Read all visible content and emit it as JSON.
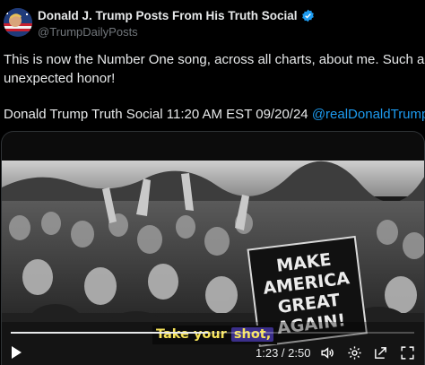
{
  "post": {
    "author_name": "Donald J. Trump Posts From His Truth Social",
    "author_handle": "@TrumpDailyPosts",
    "verified": true,
    "text_line1": "This is now the Number One song, across all charts, about me. Such an",
    "text_line2": "unexpected honor!",
    "text_line3": "Donald Trump Truth Social 11:20 AM EST 09/20/24",
    "mention": "@realDonaldTrump"
  },
  "video": {
    "sign_text": [
      "MAKE",
      "AMERICA",
      "GREAT",
      "AGAIN!"
    ],
    "caption_prefix": "Take your ",
    "caption_highlight": "shot,",
    "current_time": "1:23",
    "duration": "2:50",
    "time_display": "1:23 / 2:50",
    "progress_fraction": 0.488
  },
  "icons": {
    "play": "play-icon",
    "volume": "volume-icon",
    "settings": "gear-icon",
    "share": "share-icon",
    "fullscreen": "fullscreen-icon"
  },
  "colors": {
    "accent": "#1d9bf0",
    "caption": "#f6e35a"
  }
}
